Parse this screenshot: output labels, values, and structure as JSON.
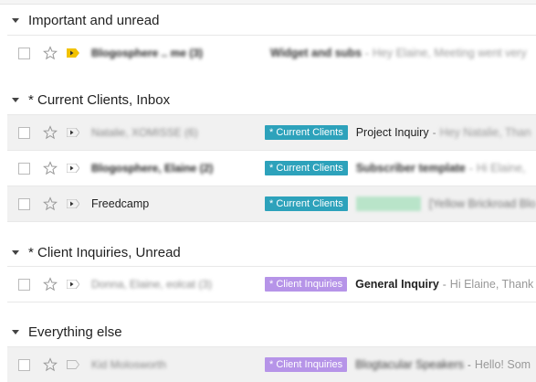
{
  "sections": [
    {
      "title": "Important and unread"
    },
    {
      "title": "* Current Clients, Inbox"
    },
    {
      "title": "* Client Inquiries, Unread"
    },
    {
      "title": "Everything else"
    }
  ],
  "rows": [
    {
      "sender": "Blogosphere .. me (3)",
      "subject": "Widget and subs",
      "snippet": "Hey Elaine, Meeting went very"
    },
    {
      "sender": "Natalie, XOMISSE (6)",
      "label": "* Current Clients",
      "subject": "Project Inquiry",
      "snippet": "Hey Natalie, Than"
    },
    {
      "sender": "Blogosphere, Elaine (2)",
      "label": "* Current Clients",
      "subject": "Subscriber template",
      "snippet": "Hi Elaine,"
    },
    {
      "sender": "Freedcamp",
      "label": "* Current Clients",
      "label2": "Account Info",
      "subject": "[Yellow Brickroad Blo",
      "snippet": ""
    },
    {
      "sender": "Donna, Elaine, eolcat (3)",
      "label": "* Client Inquiries",
      "subject": "General Inquiry",
      "snippet": "Hi Elaine, Thank"
    },
    {
      "sender": "Kid Molosworth",
      "label": "* Client Inquiries",
      "subject": "Blogtacular Speakers",
      "snippet": "Hello! Som"
    }
  ],
  "colors": {
    "current_clients_label": "#2da2bb",
    "client_inquiries_label": "#b694e8",
    "important_marker": "#f2c200"
  }
}
